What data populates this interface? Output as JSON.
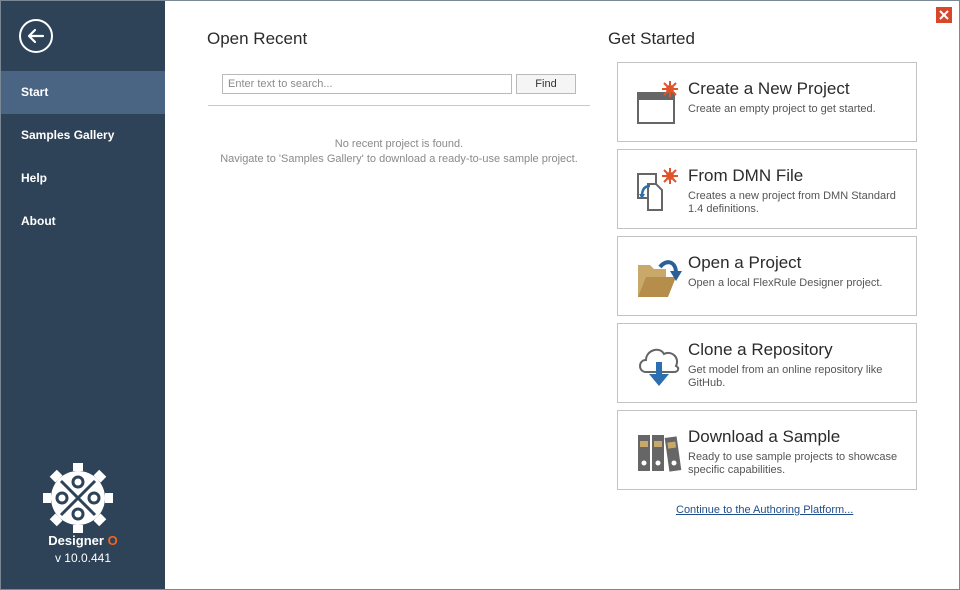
{
  "sidebar": {
    "back_icon": "arrow-left-circle-icon",
    "items": [
      {
        "label": "Start",
        "active": true
      },
      {
        "label": "Samples Gallery",
        "active": false
      },
      {
        "label": "Help",
        "active": false
      },
      {
        "label": "About",
        "active": false
      }
    ],
    "brand_name": "Designer",
    "brand_suffix": "O",
    "version": "v 10.0.441"
  },
  "open_recent": {
    "title": "Open Recent",
    "search_placeholder": "Enter text to search...",
    "find_label": "Find",
    "empty_line1": "No recent project is found.",
    "empty_line2": "Navigate to 'Samples Gallery' to download a ready-to-use sample project."
  },
  "get_started": {
    "title": "Get Started",
    "cards": [
      {
        "title": "Create a New Project",
        "desc": "Create an empty project to get started.",
        "icon": "new-project-icon"
      },
      {
        "title": "From DMN File",
        "desc": "Creates a new project from DMN Standard 1.4 definitions.",
        "icon": "dmn-file-icon"
      },
      {
        "title": "Open a Project",
        "desc": "Open a local FlexRule Designer project.",
        "icon": "open-folder-icon"
      },
      {
        "title": "Clone a Repository",
        "desc": "Get model from an online repository like GitHub.",
        "icon": "cloud-download-icon"
      },
      {
        "title": "Download a Sample",
        "desc": "Ready to use sample projects to showcase specific capabilities.",
        "icon": "binders-icon"
      }
    ],
    "continue_link": "Continue to the Authoring Platform..."
  },
  "colors": {
    "sidebar_bg": "#2e4258",
    "sidebar_active": "#4a6584",
    "accent_orange": "#f26522",
    "close_red": "#d9472b",
    "link_blue": "#1f4e8c"
  }
}
